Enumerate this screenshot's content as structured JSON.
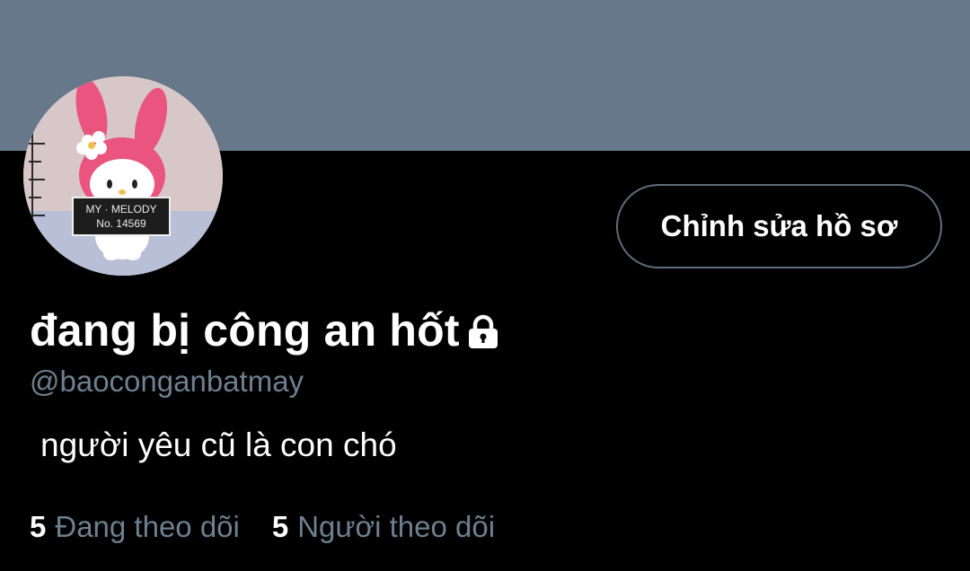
{
  "profile": {
    "display_name": "đang bị công an hốt",
    "handle": "@baoconganbatmay",
    "bio": "người yêu cũ là con chó",
    "edit_button_label": "Chỉnh sửa hồ sơ",
    "protected_icon": "lock-icon"
  },
  "avatar": {
    "sign_line1": "MY · MELODY",
    "sign_line2": "No. 14569"
  },
  "stats": {
    "following_count": "5",
    "following_label": "Đang theo dõi",
    "followers_count": "5",
    "followers_label": "Người theo dõi"
  },
  "colors": {
    "banner": "#67788a",
    "background": "#000000",
    "secondary_text": "#6e7f8f",
    "button_border": "#5f6e7c"
  }
}
